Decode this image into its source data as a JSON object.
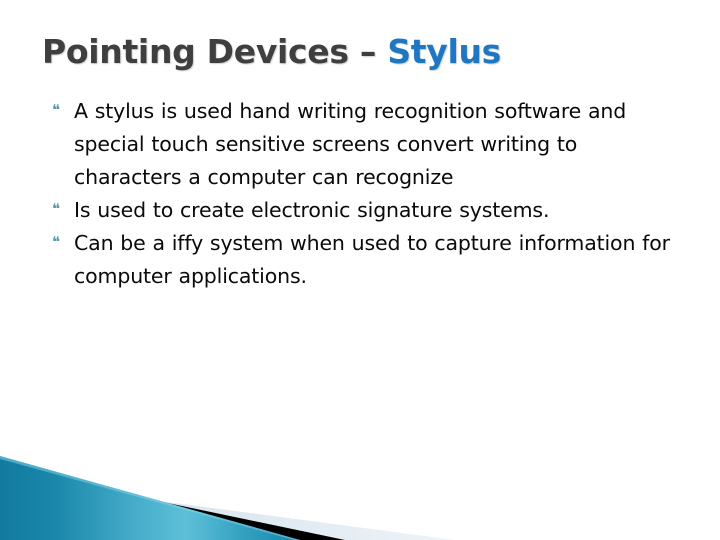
{
  "slide": {
    "title": {
      "main": "Pointing Devices – ",
      "accent": "Stylus"
    },
    "bullets": [
      {
        "marker": "❝",
        "text": "A stylus is used hand writing recognition software and special touch sensitive screens convert writing to characters a computer can recognize"
      },
      {
        "marker": "❝",
        "text": "Is used to create electronic signature systems."
      },
      {
        "marker": "❝",
        "text": "Can be a iffy system when used to capture information for computer applications."
      }
    ],
    "colors": {
      "title_main": "#3f3f3f",
      "title_accent": "#1f77c2",
      "bullet_marker": "#5a9aad",
      "body_text": "#0a0a0a",
      "background": "#ffffff",
      "wedge_blue_dark": "#137a9e",
      "wedge_blue_mid": "#5bbbd6",
      "wedge_blue_edge": "#1893b5",
      "wedge_black": "#000000",
      "wedge_pale": "#dde7ee"
    },
    "decoration": {
      "name": "bottom-left-angled-banner"
    }
  }
}
